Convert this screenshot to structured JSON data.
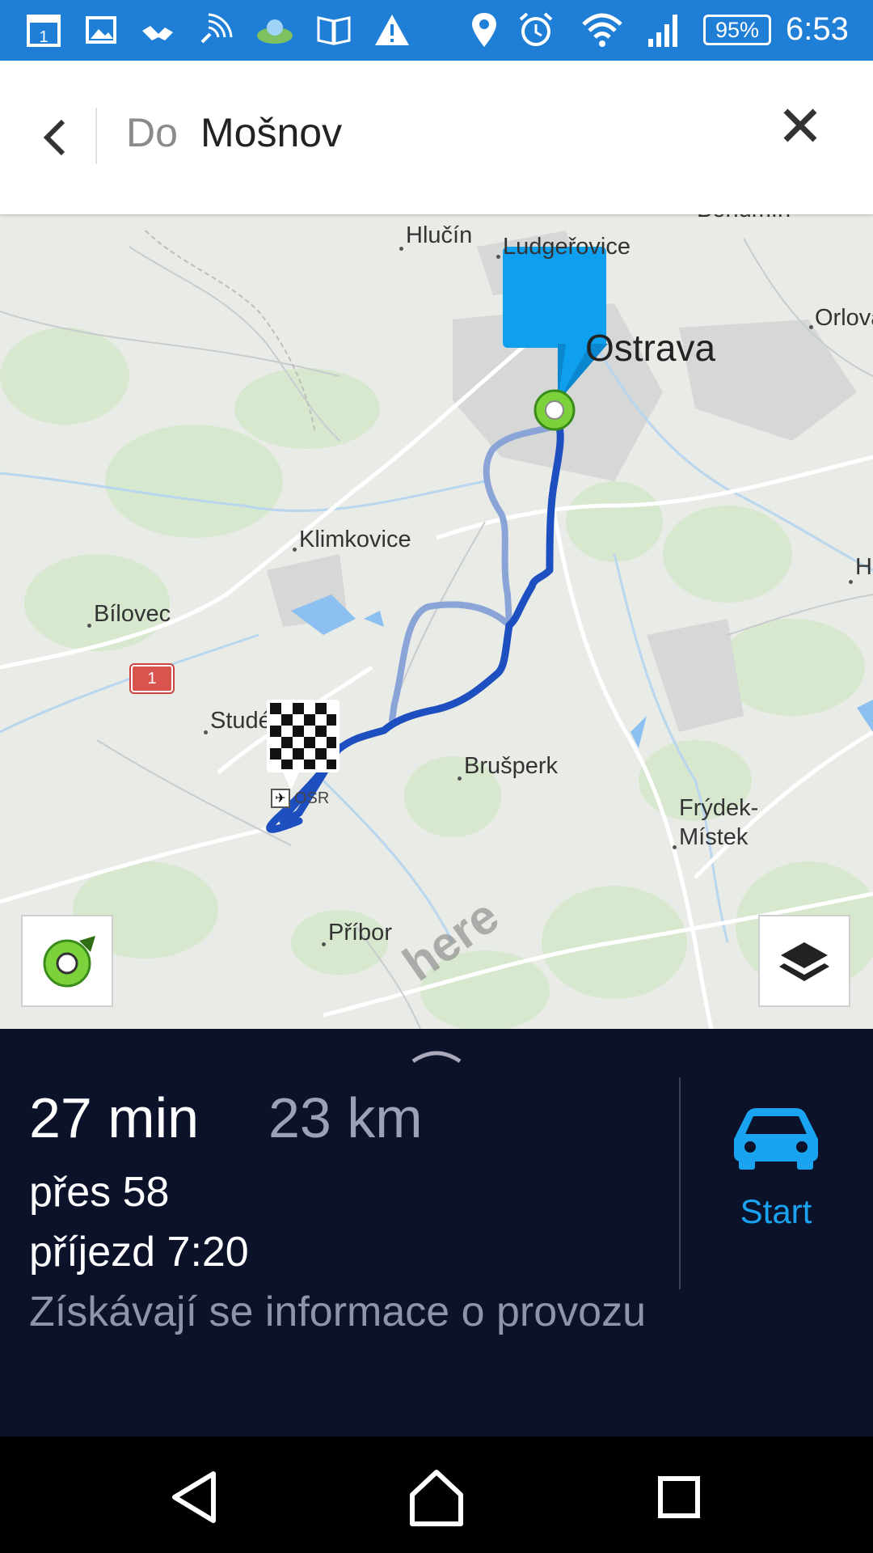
{
  "status_bar": {
    "icons": [
      "calendar-icon",
      "gallery-icon",
      "handshake-icon",
      "signal-stream-icon",
      "weather-icon",
      "book-icon",
      "warning-icon",
      "location-icon",
      "alarm-icon",
      "wifi-icon",
      "cell-signal-icon"
    ],
    "calendar_day": "1",
    "battery": "95%",
    "time": "6:53"
  },
  "header": {
    "to_prefix": "Do",
    "destination": "Mošnov"
  },
  "map": {
    "cities": {
      "hlucin": "Hlučín",
      "ludgerovice": "Ludgeřovice",
      "bohumin": "Bohumín",
      "ostrava": "Ostrava",
      "orlova": "Orlová",
      "klimkovice": "Klimkovice",
      "bilovec": "Bílovec",
      "studenka": "Studénka",
      "brusperk": "Brušperk",
      "frydek_line1": "Frýdek-",
      "frydek_line2": "Místek",
      "pribor": "Příbor",
      "havirov_partial": "H"
    },
    "road_number": "1",
    "airport_code": "OSR",
    "brand": "here",
    "colors": {
      "route_main": "#1d4fc0",
      "route_alt": "#8aa4d8",
      "start_marker": "#7bd23a",
      "pin": "#0ea0ef"
    }
  },
  "summary": {
    "duration": "27 min",
    "distance": "23 km",
    "via": "přes 58",
    "arrival": "příjezd 7:20",
    "traffic_status": "Získávají se informace o provozu",
    "start_label": "Start",
    "accent_color": "#1aa3f0"
  }
}
